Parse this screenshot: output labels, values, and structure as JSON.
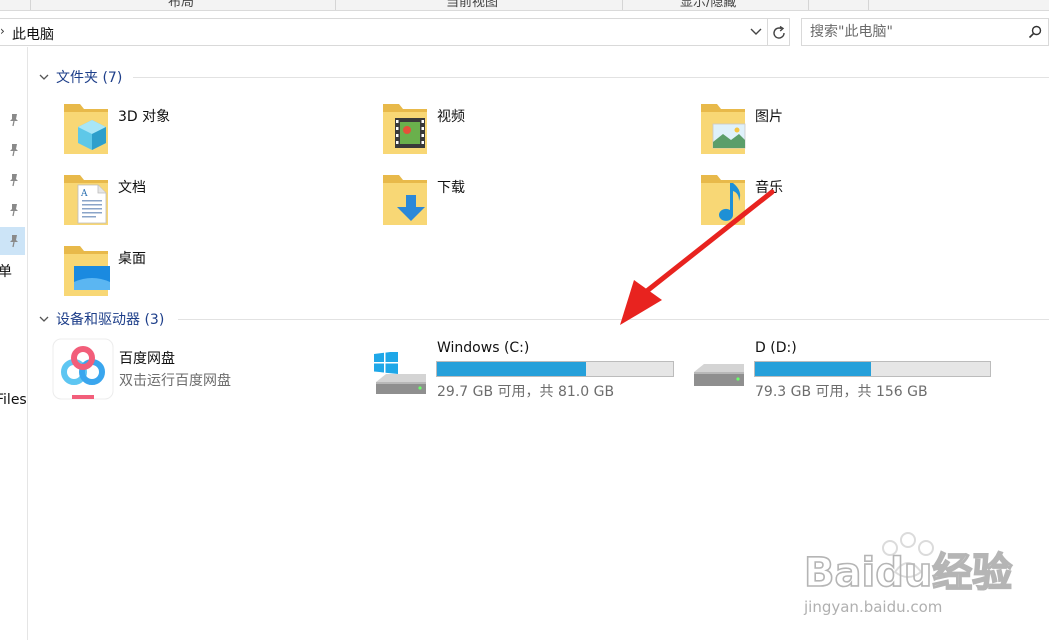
{
  "ribbon": {
    "tabs": [
      "布局",
      "当前视图",
      "显示/隐藏"
    ]
  },
  "address": {
    "path": "此电脑"
  },
  "search": {
    "placeholder": "搜索\"此电脑\""
  },
  "nav": {
    "clipped_labels": [
      "单",
      "Files"
    ]
  },
  "folders_group": {
    "title": "文件夹 (7)",
    "items": [
      {
        "label": "3D 对象",
        "icon": "3d-objects-icon"
      },
      {
        "label": "视频",
        "icon": "videos-icon"
      },
      {
        "label": "图片",
        "icon": "pictures-icon"
      },
      {
        "label": "文档",
        "icon": "documents-icon"
      },
      {
        "label": "下载",
        "icon": "downloads-icon"
      },
      {
        "label": "音乐",
        "icon": "music-icon"
      },
      {
        "label": "桌面",
        "icon": "desktop-icon"
      }
    ]
  },
  "devices_group": {
    "title": "设备和驱动器 (3)",
    "baidu": {
      "name": "百度网盘",
      "subtitle": "双击运行百度网盘"
    },
    "drives": [
      {
        "name": "Windows (C:)",
        "free_text": "29.7 GB 可用，共 81.0 GB",
        "used_fraction": 0.633
      },
      {
        "name": "D (D:)",
        "free_text": "79.3 GB 可用，共 156 GB",
        "used_fraction": 0.492
      }
    ]
  },
  "colors": {
    "accent": "#26a0da",
    "group_header": "#1e3f8a",
    "arrow": "#e8231f"
  },
  "watermark": {
    "brand": "Baidu经验",
    "url": "jingyan.baidu.com"
  }
}
